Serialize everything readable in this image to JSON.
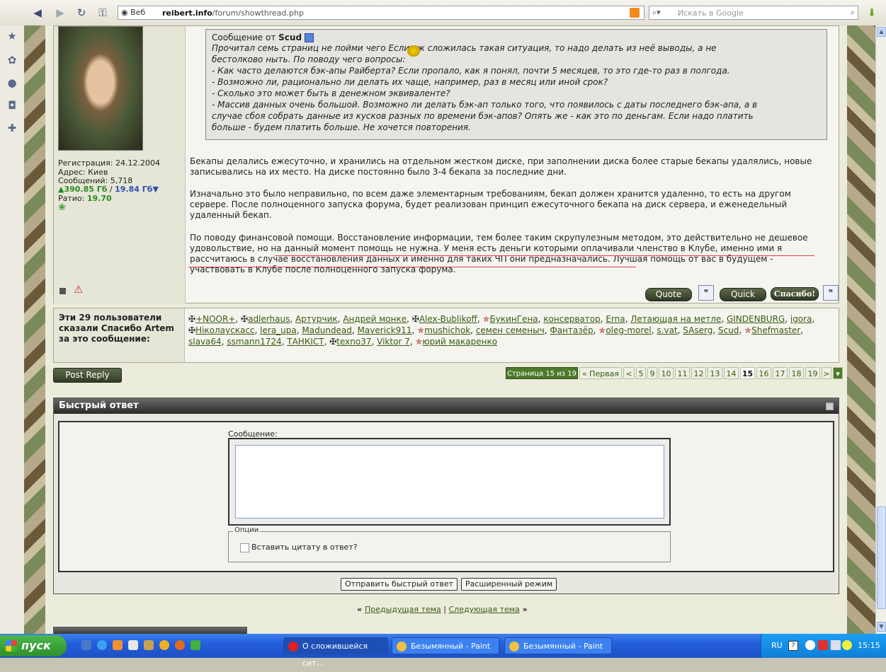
{
  "browser": {
    "web_label": "Веб",
    "url_bold": "reibert.info",
    "url_rest": "/forum/showthread.php",
    "search_placeholder": "Искать в Google"
  },
  "post": {
    "userinfo": {
      "registration": "Регистрация: 24.12.2004",
      "address": "Адрес: Киев",
      "posts": "Сообщений: 5,718",
      "upload": "▲390.85 Гб",
      "separator": " / ",
      "download": "19.84 Гб▼",
      "ratio_label": "Ратио: ",
      "ratio_value": "19.70"
    },
    "quote": {
      "prefix": "Сообщение от ",
      "author": "Scud",
      "lines": [
        "Прочитал семь страниц не пойми чего       Если уж сложилась такая ситуация, то надо делать из неё выводы, а не",
        "бестолково ныть. По поводу чего вопросы:",
        "- Как часто делаются бэк-апы Райберта? Если пропало, как я понял, почти 5 месяцев, то это где-то раз в полгода.",
        "- Возможно ли, рационально ли делать их чаще, например, раз в месяц или иной срок?",
        "- Сколько это может быть в денежном эквиваленте?",
        "- Массив данных очень большой. Возможно ли делать бэк-ап только того, что появилось с даты последнего бэк-апа, а в",
        "случае сбоя собрать данные из кусков разных по времени бэк-апов? Опять же - как это по деньгам. Если надо платить",
        "больше - будем платить больше. Не хочется повторения."
      ]
    },
    "paragraphs": [
      "Бекапы делались ежесуточно, и хранились на отдельном жестком диске, при заполнении диска более старые бекапы удалялись, новые записывались на их место. На диске постоянно было 3-4 бекапа за последние дни.",
      "Изначально это было неправильно, по всем даже элементарным требованиям, бекап должен хранится удаленно, то есть на другом сервере. После полноценного запуска форума, будет реализован принцип ежесуточного бекапа на диск сервера, и еженедельный удаленный бекап.",
      "По поводу финансовой помощи. Восстановление информации, тем более таким скрупулезным методом, это действительно не дешевое удовольствие, но на данный момент помощь не нужна. У меня есть деньги которыми оплачивали членство в Клубе, именно ими я рассчитаюсь в случае восстановления данных и именно для таких ЧП они предназначались. Лучшая помощь от вас в будущем - участвовать в Клубе после полноценного запуска форума."
    ],
    "buttons": {
      "quote": "Quote",
      "quick": "Quick",
      "thanks": "Спасибо!"
    }
  },
  "thanks": {
    "label": "Эти 29 пользователи сказали Спасибо Artem за это сообщение:",
    "users": [
      {
        "name": "+NOOR+",
        "mark": "cross"
      },
      {
        "name": "adlerhaus",
        "mark": "cross"
      },
      {
        "name": "Артурчик",
        "mark": ""
      },
      {
        "name": "Андрей монке",
        "mark": ""
      },
      {
        "name": "Alex-Bublikoff",
        "mark": "cross"
      },
      {
        "name": "БукинГена",
        "mark": "star"
      },
      {
        "name": "консерватор",
        "mark": ""
      },
      {
        "name": "Erna",
        "mark": ""
      },
      {
        "name": "Летающая на метле",
        "mark": ""
      },
      {
        "name": "GINDENBURG",
        "mark": ""
      },
      {
        "name": "igora",
        "mark": ""
      },
      {
        "name": "Ніколаускасс",
        "mark": "cross"
      },
      {
        "name": "lera_upa",
        "mark": ""
      },
      {
        "name": "Madundead",
        "mark": ""
      },
      {
        "name": "Maverick911",
        "mark": ""
      },
      {
        "name": "mushichok",
        "mark": "star"
      },
      {
        "name": "семен семеныч",
        "mark": ""
      },
      {
        "name": "Фантазёр",
        "mark": ""
      },
      {
        "name": "oleg-morel",
        "mark": "star"
      },
      {
        "name": "s.vat",
        "mark": ""
      },
      {
        "name": "SAserg",
        "mark": ""
      },
      {
        "name": "Scud",
        "mark": ""
      },
      {
        "name": "Shefmaster",
        "mark": "star"
      },
      {
        "name": "slava64",
        "mark": ""
      },
      {
        "name": "ssmann1724",
        "mark": ""
      },
      {
        "name": "ТАНКІСТ",
        "mark": ""
      },
      {
        "name": "texno37",
        "mark": "cross"
      },
      {
        "name": "Viktor 7",
        "mark": ""
      },
      {
        "name": "юрий макаренко",
        "mark": "star"
      }
    ]
  },
  "nav": {
    "post_reply": "Post Reply",
    "page_of": "Страница 15 из 19",
    "first": "« Первая",
    "prev": "<",
    "pages": [
      "5",
      "9",
      "10",
      "11",
      "12",
      "13",
      "14",
      "15",
      "16",
      "17",
      "18",
      "19"
    ],
    "current_page": "15",
    "next": ">"
  },
  "quick_reply": {
    "title": "Быстрый ответ",
    "message_label": "Сообщение:",
    "options_legend": "Опции",
    "quote_checkbox": "Вставить цитату в ответ?",
    "submit": "Отправить быстрый ответ",
    "advanced": "Расширенный режим"
  },
  "thread_nav": {
    "open": "« ",
    "prev": "Предыдущая тема",
    "sep": " | ",
    "next": "Следующая тема",
    "close": " »"
  },
  "taskbar": {
    "start": "пуск",
    "tasks": [
      {
        "label": "О сложившейся сит...",
        "color": "#e02020"
      },
      {
        "label": "Безымянный - Paint",
        "color": "#f0c040"
      },
      {
        "label": "Безымянный - Paint",
        "color": "#f0c040"
      }
    ],
    "lang": "RU",
    "time": "15:15"
  }
}
